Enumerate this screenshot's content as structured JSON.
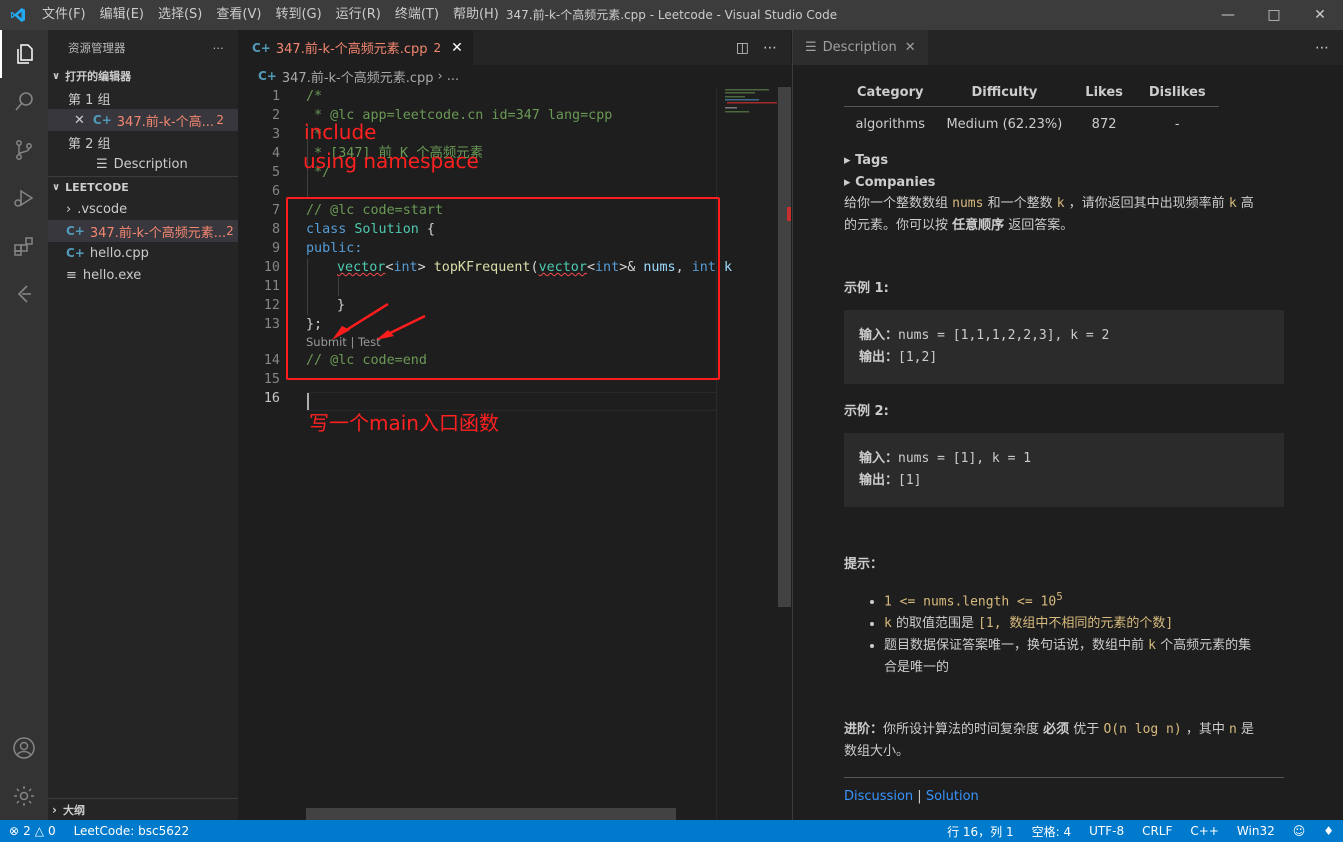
{
  "titlebar": {
    "menu": [
      "文件(F)",
      "编辑(E)",
      "选择(S)",
      "查看(V)",
      "转到(G)",
      "运行(R)",
      "终端(T)",
      "帮助(H)"
    ],
    "title": "347.前-k-个高频元素.cpp - Leetcode - Visual Studio Code"
  },
  "sidebar": {
    "title": "资源管理器",
    "open_editors_label": "打开的编辑器",
    "group1_label": "第 1 组",
    "group1_file": "347.前-k-个高...",
    "group1_badge": "2",
    "group2_label": "第 2 组",
    "group2_file": "Description",
    "workspace_label": "LEETCODE",
    "tree": {
      "vscode": ".vscode",
      "file_active": "347.前-k-个高频元素...",
      "file_active_badge": "2",
      "hello_cpp": "hello.cpp",
      "hello_exe": "hello.exe"
    },
    "outline_label": "大纲"
  },
  "editor": {
    "tab_label": "347.前-k-个高频元素.cpp",
    "tab_badge": "2",
    "breadcrumb_file": "347.前-k-个高频元素.cpp",
    "breadcrumb_rest": "...",
    "lines": {
      "l1": "/*",
      "l2": " * @lc app=leetcode.cn id=347 lang=cpp",
      "l3": " *",
      "l4": " * [347] 前 K 个高频元素",
      "l5": " */",
      "l7": "// @lc code=start",
      "l8a": "class ",
      "l8b": "Solution",
      "l8c": " {",
      "l9": "public:",
      "l10a": "vector",
      "l10b": "<",
      "l10c": "int",
      "l10d": "> ",
      "l10e": "topKFrequent",
      "l10f": "(",
      "l10g": "vector",
      "l10h": "<",
      "l10i": "int",
      "l10j": ">& ",
      "l10k": "nums",
      "l10l": ", ",
      "l10m": "int",
      "l10n": " k",
      "l12": "}",
      "l13": "};",
      "lens": "Submit | Test",
      "l14": "// @lc code=end"
    }
  },
  "annotations": {
    "include": "include",
    "using": "using namespace",
    "main_note": "写一个main入口函数"
  },
  "description": {
    "tab_label": "Description",
    "table_headers": [
      "Category",
      "Difficulty",
      "Likes",
      "Dislikes"
    ],
    "table_row": [
      "algorithms",
      "Medium (62.23%)",
      "872",
      "-"
    ],
    "tags_label": "Tags",
    "companies_label": "Companies",
    "intro_p1": "给你一个整数数组 ",
    "intro_nums": "nums",
    "intro_p2": " 和一个整数 ",
    "intro_k": "k",
    "intro_p3": " ，请你返回其中出现频率前 ",
    "intro_k2": "k",
    "intro_p4": " 高",
    "intro_line2a": "的元素。你可以按 ",
    "intro_bold": "任意顺序",
    "intro_line2b": " 返回答案。",
    "ex1_title": "示例 1:",
    "ex1_in_label": "输入：",
    "ex1_in": "nums = [1,1,1,2,2,3], k = 2",
    "ex1_out_label": "输出：",
    "ex1_out": "[1,2]",
    "ex2_title": "示例 2:",
    "ex2_in_label": "输入：",
    "ex2_in": "nums = [1], k = 1",
    "ex2_out_label": "输出：",
    "ex2_out": "[1]",
    "hint_title": "提示：",
    "hint1": "1 <= nums.length <= 10",
    "hint1_sup": "5",
    "hint2_k": "k",
    "hint2_text": " 的取值范围是 ",
    "hint2_range": "[1, 数组中不相同的元素的个数]",
    "hint3a": "题目数据保证答案唯一，换句话说，数组中前 ",
    "hint3_k": "k",
    "hint3b": " 个高频元素的集",
    "hint3c": "合是唯一的",
    "adv_label": "进阶：",
    "adv_p1": "你所设计算法的时间复杂度 ",
    "adv_bold": "必须",
    "adv_p2": " 优于 ",
    "adv_code": "O(n log n)",
    "adv_p3": " ，其中 ",
    "adv_n": "n",
    "adv_p4": " 是",
    "adv_line2": "数组大小。",
    "discussion": "Discussion",
    "sep": "|",
    "solution": "Solution"
  },
  "statusbar": {
    "errors": "2",
    "warnings": "0",
    "leetcode": "LeetCode: bsc5622",
    "position": "行 16，列 1",
    "spaces": "空格: 4",
    "encoding": "UTF-8",
    "eol": "CRLF",
    "language": "C++",
    "platform": "Win32"
  },
  "colors": {
    "accent": "#007acc",
    "error": "#f48771",
    "annotation": "#ff2020"
  }
}
